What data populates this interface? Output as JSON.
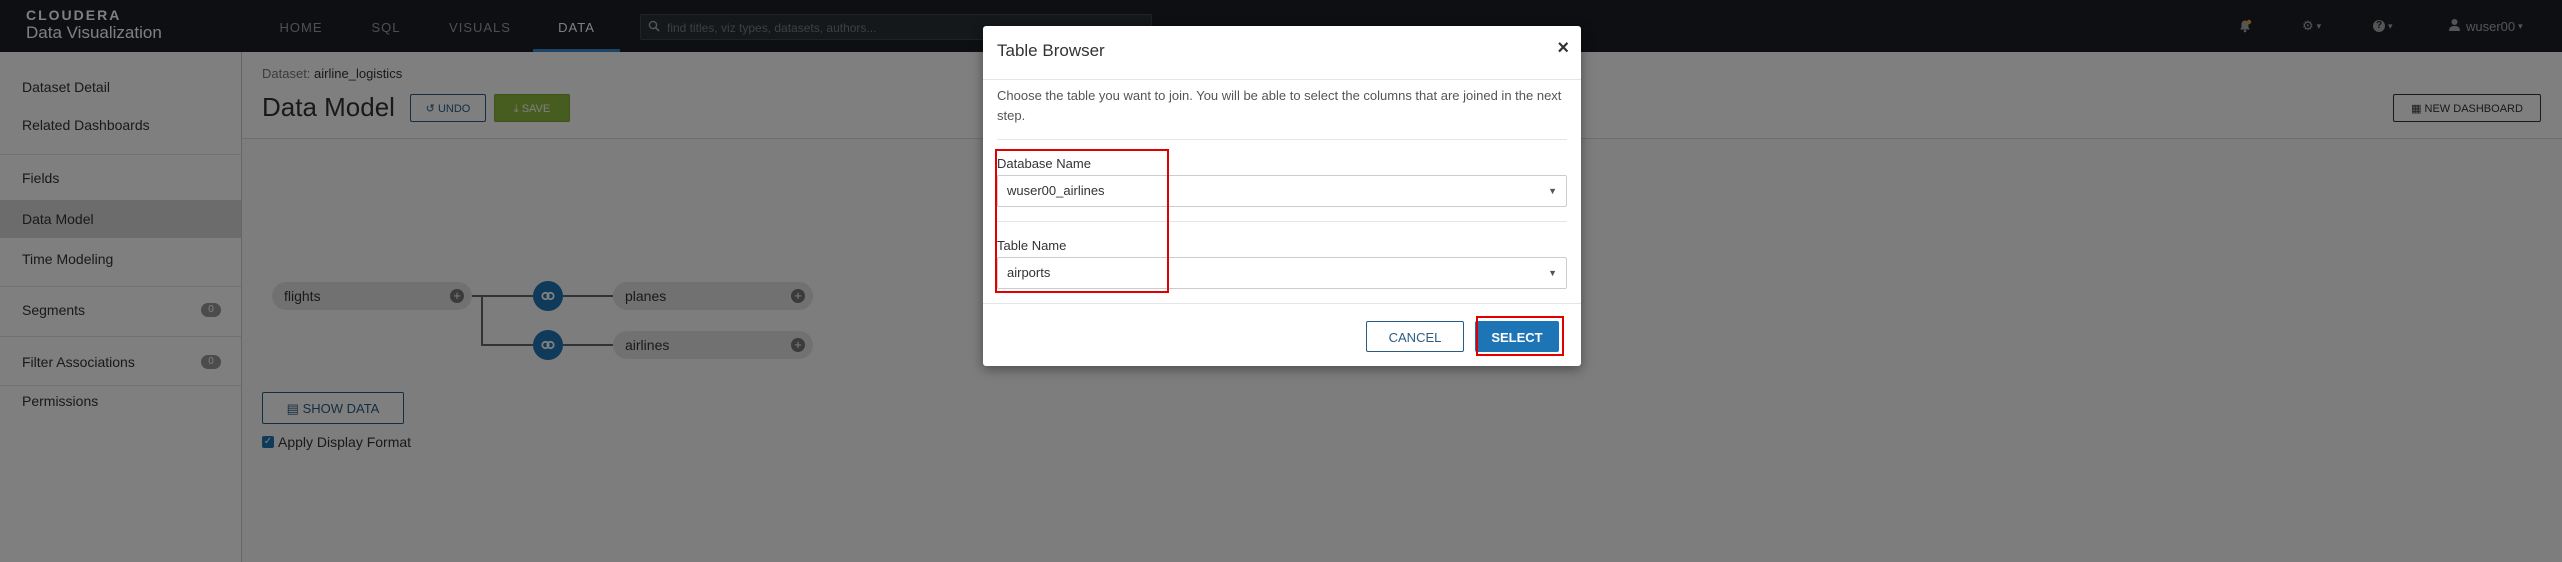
{
  "brand": {
    "name": "CLOUDERA",
    "product": "Data Visualization"
  },
  "nav": {
    "tabs": [
      {
        "label": "HOME"
      },
      {
        "label": "SQL"
      },
      {
        "label": "VISUALS"
      },
      {
        "label": "DATA"
      }
    ],
    "active_tab": "DATA",
    "search_placeholder": "find titles, viz types, datasets, authors...",
    "user": "wuser00"
  },
  "sidebar": {
    "items": [
      {
        "label": "Dataset Detail"
      },
      {
        "label": "Related Dashboards"
      },
      {
        "label": "Fields"
      },
      {
        "label": "Data Model"
      },
      {
        "label": "Time Modeling"
      },
      {
        "label": "Segments",
        "badge": "0"
      },
      {
        "label": "Filter Associations",
        "badge": "0"
      },
      {
        "label": "Permissions"
      }
    ],
    "active": "Data Model"
  },
  "main": {
    "dataset_prefix": "Dataset:",
    "dataset_name": "airline_logistics",
    "title": "Data Model",
    "undo_label": "UNDO",
    "save_label": "SAVE",
    "new_dashboard_label": "NEW DASHBOARD",
    "show_data_label": "SHOW DATA",
    "apply_display_format_label": "Apply Display Format",
    "apply_display_format_checked": true
  },
  "model": {
    "tables": [
      {
        "name": "flights"
      },
      {
        "name": "planes"
      },
      {
        "name": "airlines"
      }
    ]
  },
  "modal": {
    "title": "Table Browser",
    "close": "×",
    "description": "Choose the table you want to join. You will be able to select the columns that are joined in the next step.",
    "database_label": "Database Name",
    "database_value": "wuser00_airlines",
    "table_label": "Table Name",
    "table_value": "airports",
    "cancel_label": "CANCEL",
    "select_label": "SELECT"
  },
  "colors": {
    "navbar": "#1b1f24",
    "accent": "#1e75b5",
    "save": "#8cba3f",
    "highlight": "#e00000"
  }
}
